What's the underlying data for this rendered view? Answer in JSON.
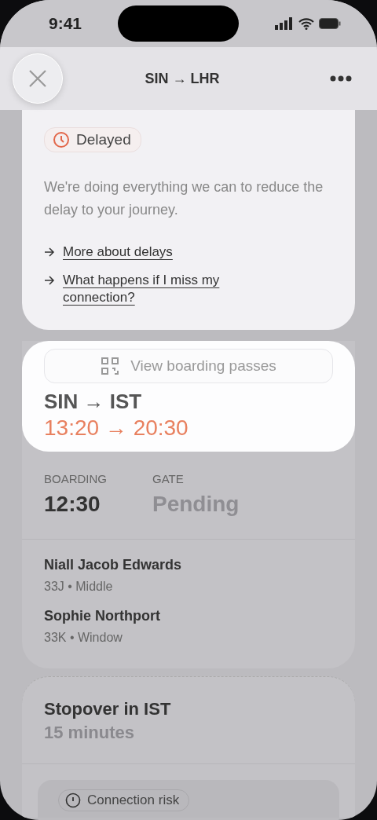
{
  "status_bar": {
    "time": "9:41"
  },
  "header": {
    "title": "SIN → LHR"
  },
  "delay_sheet": {
    "status": "Delayed",
    "message": "We're doing everything we can to reduce the delay to your journey.",
    "links": [
      "More about delays",
      "What happens if I miss my connection?"
    ],
    "button": "View boarding passes"
  },
  "flight": {
    "route": "SIN → IST",
    "times": "13:20 → 20:30",
    "boarding_label": "BOARDING",
    "boarding_time": "12:30",
    "gate_label": "GATE",
    "gate": "Pending",
    "passengers": [
      {
        "name": "Niall Jacob Edwards",
        "seat": "33J • Middle"
      },
      {
        "name": "Sophie Northport",
        "seat": "33K • Window"
      }
    ]
  },
  "stopover": {
    "title": "Stopover in IST",
    "duration": "15 minutes",
    "risk": "Connection risk"
  }
}
